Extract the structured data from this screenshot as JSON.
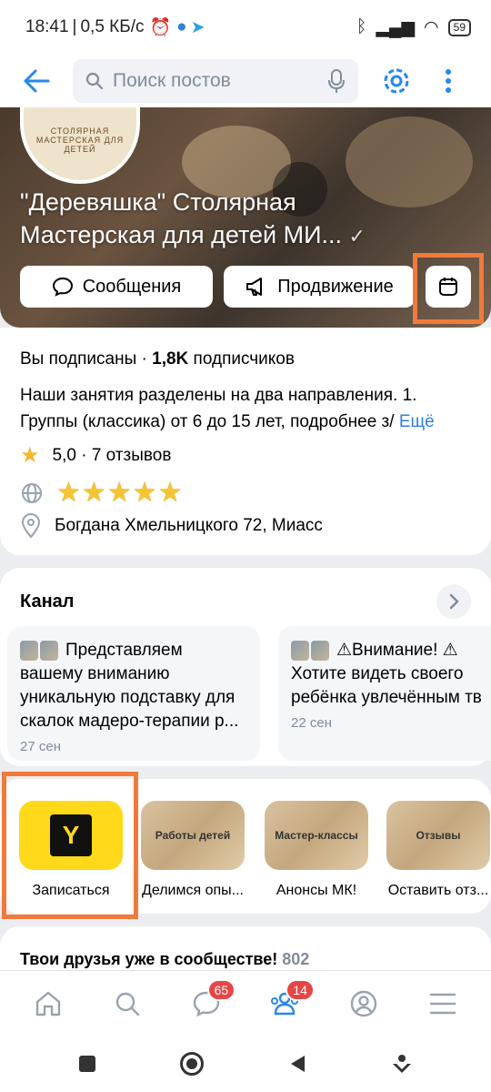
{
  "status_bar": {
    "time": "18:41",
    "speed": "0,5 КБ/с",
    "battery": "59"
  },
  "header": {
    "search_placeholder": "Поиск постов"
  },
  "group": {
    "avatar_text": "СТОЛЯРНАЯ МАСТЕРСКАЯ ДЛЯ ДЕТЕЙ",
    "name": "\"Деревяшка\" Столярная Мастерская для детей МИ...",
    "messages_label": "Сообщения",
    "promote_label": "Продвижение"
  },
  "info": {
    "subscribed": "Вы подписаны · ",
    "subscribers_count": "1,8K",
    "subscribers_label": " подписчиков",
    "description": "Наши занятия разделены на два направления. 1. Группы (классика) от 6 до 15 лет, подробнее з/",
    "more": "Ещё",
    "rating": "5,0 · 7 отзывов",
    "stars": "★★★★★",
    "address": "Богдана Хмельницкого 72, Миасс"
  },
  "channel": {
    "title": "Канал",
    "posts": [
      {
        "text": "Представляем вашему вниманию уникальную подставку для скалок мадеро-терапии р...",
        "date": "27 сен"
      },
      {
        "text": "⚠Внимание! ⚠ Хотите видеть своего ребёнка увлечённым тв",
        "date": "22 сен"
      }
    ]
  },
  "apps": [
    {
      "label": "Записаться",
      "icon_text": ""
    },
    {
      "label": "Делимся опы...",
      "icon_text": "Работы детей"
    },
    {
      "label": "Анонсы МК!",
      "icon_text": "Мастер-классы"
    },
    {
      "label": "Оставить отз...",
      "icon_text": "Отзывы"
    }
  ],
  "friends": {
    "title": "Твои друзья уже в сообществе!",
    "count": "802"
  },
  "tabbar": {
    "messages_badge": "65",
    "community_badge": "14"
  },
  "colors": {
    "accent": "#2688eb",
    "highlight": "#f07a3a",
    "badge": "#e64646"
  }
}
